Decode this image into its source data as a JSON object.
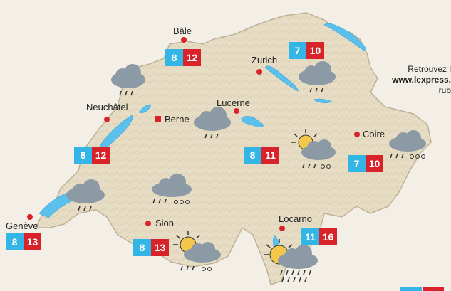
{
  "colors": {
    "land": "#e7ddc5",
    "land_edge": "#bdb095",
    "lake": "#5cc0ec",
    "low_temp": "#33b5e5",
    "high_temp": "#d8232a",
    "city_dot": "#d8232a",
    "cloud": "#8c9aa6"
  },
  "cities": [
    {
      "id": "bale",
      "name": "Bâle",
      "low": "8",
      "high": "12",
      "marker": "dot"
    },
    {
      "id": "zurich",
      "name": "Zurich",
      "low": "7",
      "high": "10",
      "marker": "dot"
    },
    {
      "id": "neuchatel",
      "name": "Neuchâtel",
      "low": "8",
      "high": "12",
      "marker": "dot"
    },
    {
      "id": "berne",
      "name": "Berne",
      "marker": "square"
    },
    {
      "id": "lucerne",
      "name": "Lucerne",
      "low": "8",
      "high": "11",
      "marker": "dot"
    },
    {
      "id": "coire",
      "name": "Coire",
      "low": "7",
      "high": "10",
      "marker": "dot"
    },
    {
      "id": "geneve",
      "name": "Genève",
      "low": "8",
      "high": "13",
      "marker": "dot"
    },
    {
      "id": "sion",
      "name": "Sion",
      "low": "8",
      "high": "13",
      "marker": "dot"
    },
    {
      "id": "locarno",
      "name": "Locarno",
      "low": "11",
      "high": "16",
      "marker": "dot"
    }
  ],
  "weather_icons": [
    {
      "id": "jura-north",
      "icon": "rain-cloud-icon"
    },
    {
      "id": "zurich",
      "icon": "rain-cloud-icon"
    },
    {
      "id": "lucerne",
      "icon": "rain-cloud-icon"
    },
    {
      "id": "central-alps",
      "icon": "sun-cloud-rain-snow-icon"
    },
    {
      "id": "coire",
      "icon": "rain-snow-cloud-icon"
    },
    {
      "id": "west",
      "icon": "rain-cloud-icon"
    },
    {
      "id": "fribourg-alps",
      "icon": "rain-snow-cloud-icon"
    },
    {
      "id": "sion",
      "icon": "sun-cloud-rain-snow-icon"
    },
    {
      "id": "locarno",
      "icon": "sun-cloud-heavy-rain-icon"
    }
  ],
  "promo": {
    "line1": "Retrouvez l",
    "line2": "www.lexpress.",
    "line3": "rub"
  }
}
